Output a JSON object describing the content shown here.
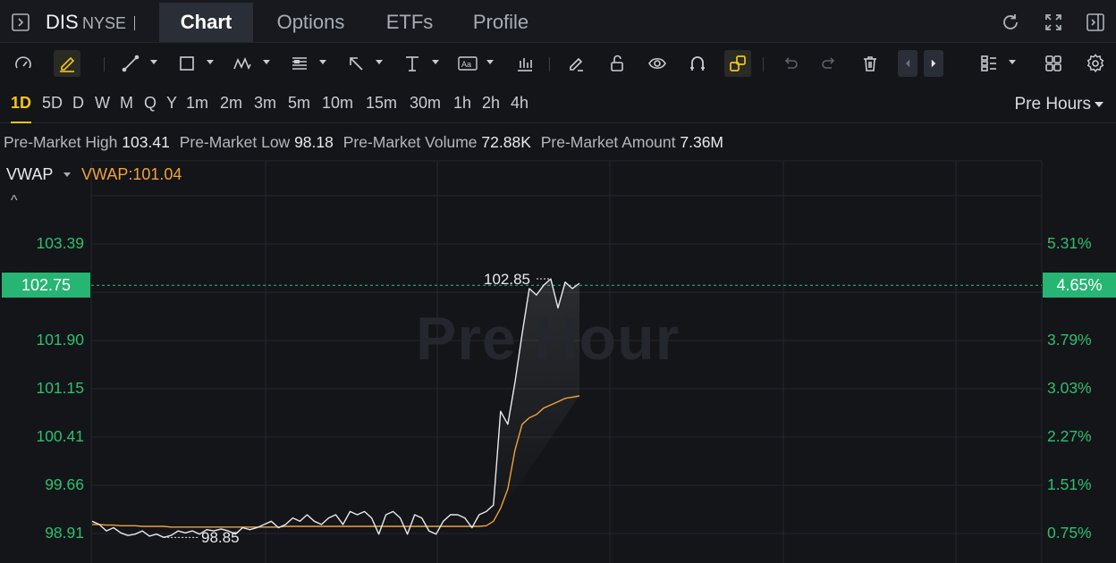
{
  "header": {
    "symbol": "DIS",
    "exchange": "NYSE",
    "tabs": [
      {
        "label": "Chart",
        "active": true
      },
      {
        "label": "Options",
        "active": false
      },
      {
        "label": "ETFs",
        "active": false
      },
      {
        "label": "Profile",
        "active": false
      }
    ],
    "icons": [
      "panel-toggle-icon",
      "refresh-icon",
      "fullscreen-icon",
      "side-panel-icon"
    ]
  },
  "toolbar": {
    "tools": [
      "indicator-gauge-icon",
      "pencil-icon",
      "line-tool-icon",
      "rectangle-tool-icon",
      "pattern-tool-icon",
      "fib-tool-icon",
      "arrow-tool-icon",
      "measure-tool-icon",
      "text-tool-icon",
      "bar-chart-icon",
      "brush-icon",
      "unlock-icon",
      "eye-icon",
      "magnet-icon",
      "link-icon",
      "undo-icon",
      "redo-icon",
      "trash-icon",
      "prev-icon",
      "next-icon",
      "layout-icon",
      "grid-icon",
      "settings-icon"
    ],
    "text_tool_glyph": "Aa"
  },
  "timeframes": {
    "items": [
      "1D",
      "5D",
      "D",
      "W",
      "M",
      "Q",
      "Y",
      "1m",
      "2m",
      "3m",
      "5m",
      "10m",
      "15m",
      "30m",
      "1h",
      "2h",
      "4h"
    ],
    "active": "1D",
    "session": "Pre Hours"
  },
  "info": {
    "high_label": "Pre-Market High",
    "high_value": "103.41",
    "low_label": "Pre-Market Low",
    "low_value": "98.18",
    "volume_label": "Pre-Market Volume",
    "volume_value": "72.88K",
    "amount_label": "Pre-Market Amount",
    "amount_value": "7.36M"
  },
  "indicator": {
    "name": "VWAP",
    "value_text": "VWAP:101.04",
    "collapse_glyph": "^"
  },
  "colors": {
    "up": "#2fbf71",
    "price_line": "#e8eaee",
    "vwap_line": "#f0a23b",
    "accent": "#f5c518"
  },
  "chart_data": {
    "type": "line",
    "watermark": "Pre Hour",
    "left_axis": [
      "103.39",
      "101.90",
      "101.15",
      "100.41",
      "99.66",
      "98.91"
    ],
    "right_axis": [
      "5.31%",
      "3.79%",
      "3.03%",
      "2.27%",
      "1.51%",
      "0.75%"
    ],
    "current_price": "102.75",
    "current_change": "4.65%",
    "max_label": "102.85",
    "min_label": "98.85",
    "ylim": [
      98.6,
      103.9
    ],
    "series": [
      {
        "key": "price",
        "values": [
          99.1,
          99.05,
          98.95,
          99.0,
          98.92,
          98.88,
          98.9,
          98.95,
          98.87,
          98.9,
          98.85,
          98.88,
          98.95,
          98.92,
          98.95,
          98.9,
          98.97,
          98.95,
          98.98,
          98.95,
          98.9,
          99.0,
          98.97,
          99.0,
          99.05,
          99.1,
          99.0,
          99.05,
          99.15,
          99.1,
          99.2,
          99.1,
          99.05,
          99.15,
          99.2,
          99.05,
          99.25,
          99.2,
          99.25,
          99.15,
          98.9,
          99.2,
          99.25,
          99.15,
          98.9,
          99.2,
          99.15,
          98.95,
          98.9,
          99.1,
          99.2,
          99.2,
          99.15,
          99.0,
          99.2,
          99.25,
          99.35,
          100.8,
          100.6,
          101.25,
          102.0,
          102.7,
          102.6,
          102.75,
          102.85,
          102.4,
          102.8,
          102.7,
          102.78
        ]
      },
      {
        "key": "vwap",
        "values": [
          99.05,
          99.05,
          99.04,
          99.04,
          99.03,
          99.03,
          99.03,
          99.02,
          99.02,
          99.02,
          99.02,
          99.01,
          99.01,
          99.01,
          99.01,
          99.01,
          99.01,
          99.01,
          99.01,
          99.01,
          99.01,
          99.01,
          99.01,
          99.01,
          99.01,
          99.01,
          99.01,
          99.02,
          99.02,
          99.02,
          99.02,
          99.02,
          99.02,
          99.02,
          99.02,
          99.02,
          99.02,
          99.02,
          99.02,
          99.02,
          99.02,
          99.02,
          99.02,
          99.02,
          99.02,
          99.02,
          99.02,
          99.02,
          99.02,
          99.02,
          99.02,
          99.02,
          99.02,
          99.02,
          99.02,
          99.03,
          99.1,
          99.3,
          99.6,
          100.2,
          100.6,
          100.7,
          100.75,
          100.85,
          100.9,
          100.95,
          101.0,
          101.02,
          101.04
        ]
      }
    ]
  }
}
